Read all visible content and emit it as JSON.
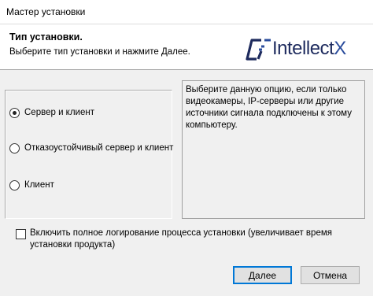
{
  "window": {
    "title": "Мастер установки"
  },
  "header": {
    "title": "Тип установки.",
    "subtitle": "Выберите тип установки и нажмите Далее.",
    "logo_text": "Intellect",
    "logo_suffix": "X",
    "logo_color": "#1e2b5e"
  },
  "options": [
    {
      "label": "Сервер и клиент",
      "checked": true
    },
    {
      "label": "Отказоустойчивый сервер и клиент",
      "checked": false
    },
    {
      "label": "Клиент",
      "checked": false
    }
  ],
  "description": "Выберите данную опцию, если только видеокамеры, IP-серверы или другие источники сигнала подключены к этому компьютеру.",
  "logging": {
    "label": "Включить полное логирование процесса установки (увеличивает время установки продукта)",
    "checked": false
  },
  "buttons": {
    "next": "Далее",
    "cancel": "Отмена",
    "accent_color": "#0078d7"
  }
}
